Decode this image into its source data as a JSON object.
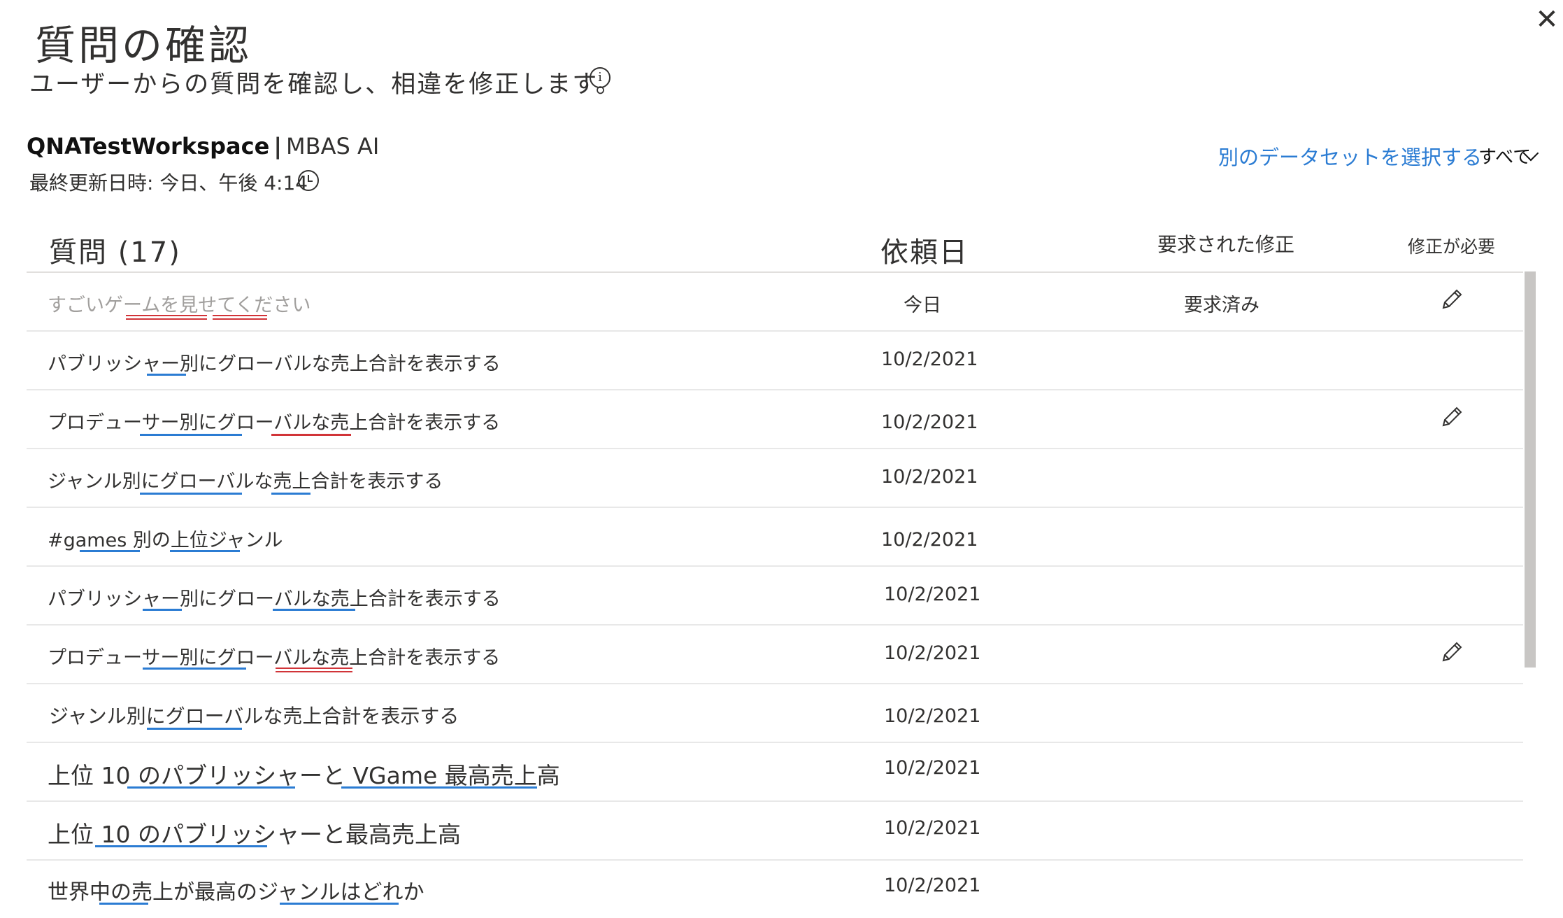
{
  "header": {
    "title": "質問の確認",
    "subtitle": "ユーザーからの質問を確認し、相違を修正します。",
    "info_icon": "info-icon",
    "close_icon": "close-icon"
  },
  "workspace": {
    "name": "QNATestWorkspace",
    "separator": "|",
    "dataset": "MBAS AI",
    "updated": "最終更新日時: 今日、午後 4:14"
  },
  "toolbar": {
    "select_dataset_link": "別のデータセットを選択する",
    "filter_label": "すべて"
  },
  "table": {
    "col_question": "質問 (17)",
    "col_date": "依頼日",
    "col_requested": "要求された修正",
    "col_needs_fix": "修正が必要",
    "rows": [
      {
        "question": "すごいゲームを見せてください",
        "date": "今日",
        "requested": "要求済み",
        "needs_fix": true
      },
      {
        "question": "パブリッシャー別にグローバルな売上合計を表示する",
        "date": "10/2/2021",
        "requested": "",
        "needs_fix": false
      },
      {
        "question": "プロデューサー別にグローバルな売上合計を表示する",
        "date": "10/2/2021",
        "requested": "",
        "needs_fix": true
      },
      {
        "question": "ジャンル別にグローバルな売上合計を表示する",
        "date": "10/2/2021",
        "requested": "",
        "needs_fix": false
      },
      {
        "question": "#games 別の上位ジャンル",
        "date": "10/2/2021",
        "requested": "",
        "needs_fix": false
      },
      {
        "question": "パブリッシャー別にグローバルな売上合計を表示する",
        "date": "10/2/2021",
        "requested": "",
        "needs_fix": false
      },
      {
        "question": "プロデューサー別にグローバルな売上合計を表示する",
        "date": "10/2/2021",
        "requested": "",
        "needs_fix": true
      },
      {
        "question": "ジャンル別にグローバルな売上合計を表示する",
        "date": "10/2/2021",
        "requested": "",
        "needs_fix": false
      },
      {
        "question": "上位 10 のパブリッシャーと VGame 最高売上高",
        "date": "10/2/2021",
        "requested": "",
        "needs_fix": false
      },
      {
        "question": "上位 10 のパブリッシャーと最高売上高",
        "date": "10/2/2021",
        "requested": "",
        "needs_fix": false
      },
      {
        "question": "世界中の売上が最高のジャンルはどれか",
        "date": "10/2/2021",
        "requested": "",
        "needs_fix": false
      }
    ]
  },
  "colors": {
    "link": "#2b7cd3",
    "underline_red": "#d13438",
    "underline_blue": "#2b7cd3",
    "muted_text": "#a19f9d"
  },
  "icons": {
    "edit": "pencil-icon",
    "clock": "clock-icon",
    "filter": "chevron-down-icon"
  }
}
